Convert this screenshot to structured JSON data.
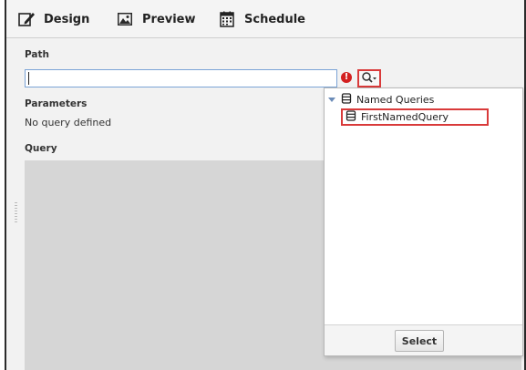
{
  "toolbar": {
    "design_label": "Design",
    "preview_label": "Preview",
    "schedule_label": "Schedule"
  },
  "path": {
    "label": "Path",
    "value": "",
    "placeholder": ""
  },
  "error_icon": {
    "glyph": "!",
    "icon": "error-icon",
    "color": "#d32020"
  },
  "search_button": {
    "icon": "search-dropdown-icon",
    "highlight_color": "#d93a3a"
  },
  "parameters": {
    "label": "Parameters",
    "empty_text": "No query defined"
  },
  "query": {
    "label": "Query"
  },
  "browser_popup": {
    "root_label": "Named Queries",
    "items": [
      {
        "label": "FirstNamedQuery",
        "highlighted": true
      }
    ],
    "select_label": "Select"
  },
  "colors": {
    "accent_highlight": "#d93a3a",
    "input_border": "#7aa3d6",
    "query_area": "#d6d6d6"
  }
}
